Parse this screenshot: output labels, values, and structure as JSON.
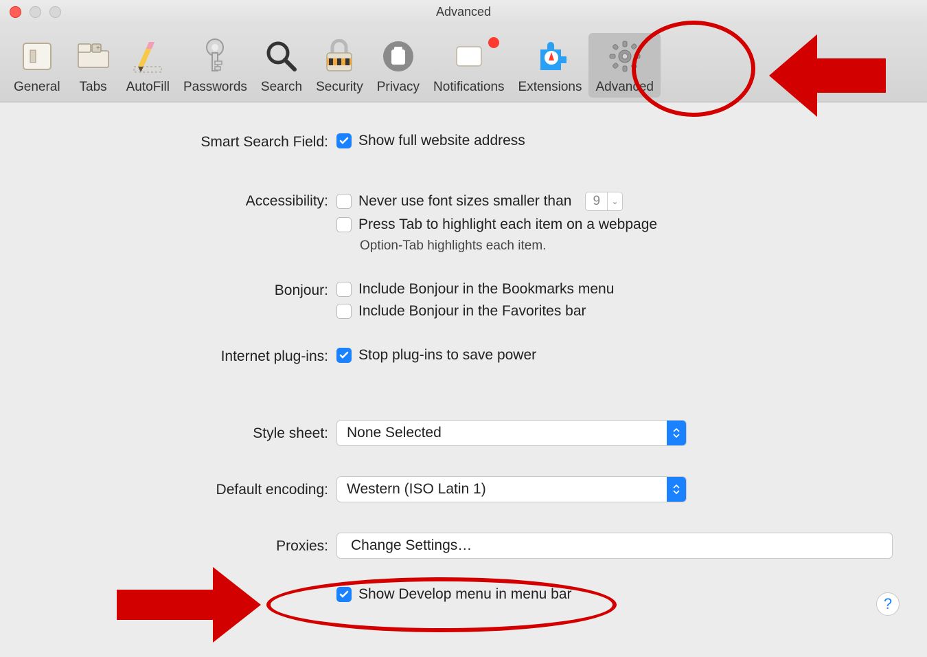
{
  "window": {
    "title": "Advanced"
  },
  "toolbar": [
    {
      "key": "general",
      "label": "General"
    },
    {
      "key": "tabs",
      "label": "Tabs"
    },
    {
      "key": "autofill",
      "label": "AutoFill"
    },
    {
      "key": "passwords",
      "label": "Passwords"
    },
    {
      "key": "search",
      "label": "Search"
    },
    {
      "key": "security",
      "label": "Security"
    },
    {
      "key": "privacy",
      "label": "Privacy"
    },
    {
      "key": "notifications",
      "label": "Notifications"
    },
    {
      "key": "extensions",
      "label": "Extensions"
    },
    {
      "key": "advanced",
      "label": "Advanced"
    }
  ],
  "sections": {
    "smart_search": {
      "label": "Smart Search Field:",
      "show_full": "Show full website address"
    },
    "accessibility": {
      "label": "Accessibility:",
      "min_font": "Never use font sizes smaller than",
      "min_font_value": "9",
      "press_tab": "Press Tab to highlight each item on a webpage",
      "hint": "Option-Tab highlights each item."
    },
    "bonjour": {
      "label": "Bonjour:",
      "bookmarks": "Include Bonjour in the Bookmarks menu",
      "favorites": "Include Bonjour in the Favorites bar"
    },
    "plugins": {
      "label": "Internet plug-ins:",
      "stop": "Stop plug-ins to save power"
    },
    "style_sheet": {
      "label": "Style sheet:",
      "value": "None Selected"
    },
    "encoding": {
      "label": "Default encoding:",
      "value": "Western (ISO Latin 1)"
    },
    "proxies": {
      "label": "Proxies:",
      "button": "Change Settings…"
    },
    "develop": {
      "label": "Show Develop menu in menu bar"
    }
  },
  "help_label": "?"
}
